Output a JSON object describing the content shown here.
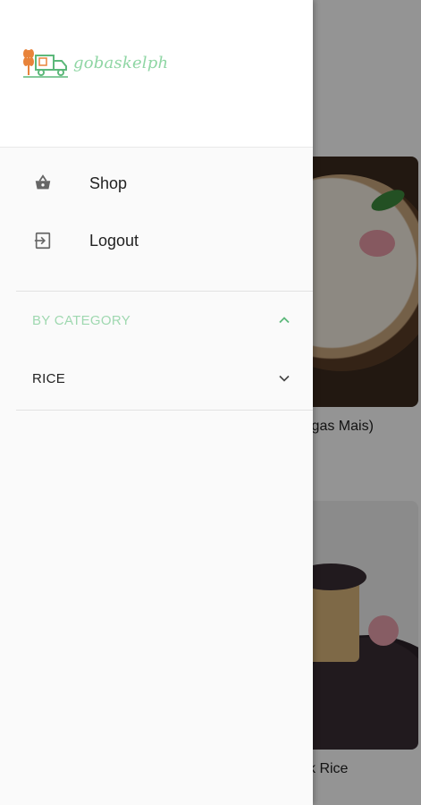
{
  "app": {
    "logo_text": "gobaskelph"
  },
  "drawer": {
    "menu": [
      {
        "label": "Shop",
        "icon": "basket-icon"
      },
      {
        "label": "Logout",
        "icon": "logout-icon"
      }
    ],
    "category_section": {
      "title": "BY CATEGORY",
      "expanded": true,
      "items": [
        {
          "label": "RICE",
          "expanded": false
        }
      ]
    }
  },
  "background": {
    "products": [
      {
        "caption": "igas Mais)"
      },
      {
        "caption": "k Rice"
      }
    ]
  },
  "colors": {
    "accent": "#9fd8b0",
    "logo_orange": "#e8833a",
    "logo_green": "#5cb87a",
    "scrim": "#6b6b6b"
  }
}
